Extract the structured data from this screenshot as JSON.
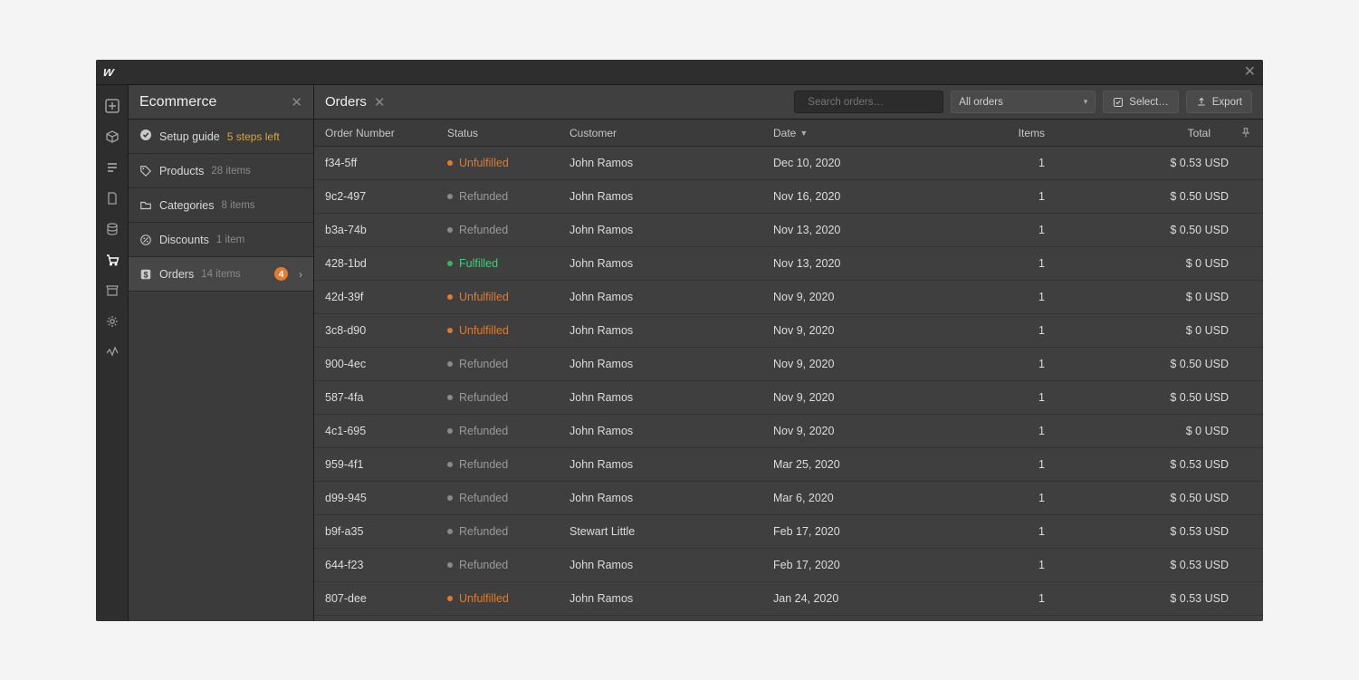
{
  "titlebar": {
    "logo": "w"
  },
  "sidebar": {
    "title": "Ecommerce",
    "setup_label": "Setup guide",
    "setup_steps": "5 steps left",
    "items": [
      {
        "icon": "tag-icon",
        "label": "Products",
        "meta": "28 items"
      },
      {
        "icon": "folder-icon",
        "label": "Categories",
        "meta": "8 items"
      },
      {
        "icon": "percent-icon",
        "label": "Discounts",
        "meta": "1 item"
      },
      {
        "icon": "dollar-icon",
        "label": "Orders",
        "meta": "14 items",
        "badge": "4",
        "selected": true,
        "chevron": true
      }
    ]
  },
  "orders": {
    "title": "Orders",
    "search_placeholder": "Search orders…",
    "filter_label": "All orders",
    "select_btn": "Select…",
    "export_btn": "Export",
    "columns": {
      "order": "Order Number",
      "status": "Status",
      "customer": "Customer",
      "date": "Date",
      "items": "Items",
      "total": "Total"
    },
    "rows": [
      {
        "order": "f34-5ff",
        "status": "Unfulfilled",
        "status_color": "orange",
        "customer": "John Ramos",
        "date": "Dec 10, 2020",
        "items": "1",
        "total": "$ 0.53 USD"
      },
      {
        "order": "9c2-497",
        "status": "Refunded",
        "status_color": "gray",
        "customer": "John Ramos",
        "date": "Nov 16, 2020",
        "items": "1",
        "total": "$ 0.50 USD"
      },
      {
        "order": "b3a-74b",
        "status": "Refunded",
        "status_color": "gray",
        "customer": "John Ramos",
        "date": "Nov 13, 2020",
        "items": "1",
        "total": "$ 0.50 USD"
      },
      {
        "order": "428-1bd",
        "status": "Fulfilled",
        "status_color": "green",
        "customer": "John Ramos",
        "date": "Nov 13, 2020",
        "items": "1",
        "total": "$ 0 USD"
      },
      {
        "order": "42d-39f",
        "status": "Unfulfilled",
        "status_color": "orange",
        "customer": "John Ramos",
        "date": "Nov 9, 2020",
        "items": "1",
        "total": "$ 0 USD"
      },
      {
        "order": "3c8-d90",
        "status": "Unfulfilled",
        "status_color": "orange",
        "customer": "John Ramos",
        "date": "Nov 9, 2020",
        "items": "1",
        "total": "$ 0 USD"
      },
      {
        "order": "900-4ec",
        "status": "Refunded",
        "status_color": "gray",
        "customer": "John Ramos",
        "date": "Nov 9, 2020",
        "items": "1",
        "total": "$ 0.50 USD"
      },
      {
        "order": "587-4fa",
        "status": "Refunded",
        "status_color": "gray",
        "customer": "John Ramos",
        "date": "Nov 9, 2020",
        "items": "1",
        "total": "$ 0.50 USD"
      },
      {
        "order": "4c1-695",
        "status": "Refunded",
        "status_color": "gray",
        "customer": "John Ramos",
        "date": "Nov 9, 2020",
        "items": "1",
        "total": "$ 0 USD"
      },
      {
        "order": "959-4f1",
        "status": "Refunded",
        "status_color": "gray",
        "customer": "John Ramos",
        "date": "Mar 25, 2020",
        "items": "1",
        "total": "$ 0.53 USD"
      },
      {
        "order": "d99-945",
        "status": "Refunded",
        "status_color": "gray",
        "customer": "John Ramos",
        "date": "Mar 6, 2020",
        "items": "1",
        "total": "$ 0.50 USD"
      },
      {
        "order": "b9f-a35",
        "status": "Refunded",
        "status_color": "gray",
        "customer": "Stewart Little",
        "date": "Feb 17, 2020",
        "items": "1",
        "total": "$ 0.53 USD"
      },
      {
        "order": "644-f23",
        "status": "Refunded",
        "status_color": "gray",
        "customer": "John Ramos",
        "date": "Feb 17, 2020",
        "items": "1",
        "total": "$ 0.53 USD"
      },
      {
        "order": "807-dee",
        "status": "Unfulfilled",
        "status_color": "orange",
        "customer": "John Ramos",
        "date": "Jan 24, 2020",
        "items": "1",
        "total": "$ 0.53 USD"
      }
    ]
  },
  "rail": [
    {
      "name": "add-icon"
    },
    {
      "name": "box-icon"
    },
    {
      "name": "list-icon"
    },
    {
      "name": "page-icon"
    },
    {
      "name": "database-icon"
    },
    {
      "name": "cart-icon",
      "active": true
    },
    {
      "name": "store-icon"
    },
    {
      "name": "gear-icon"
    },
    {
      "name": "activity-icon"
    }
  ]
}
